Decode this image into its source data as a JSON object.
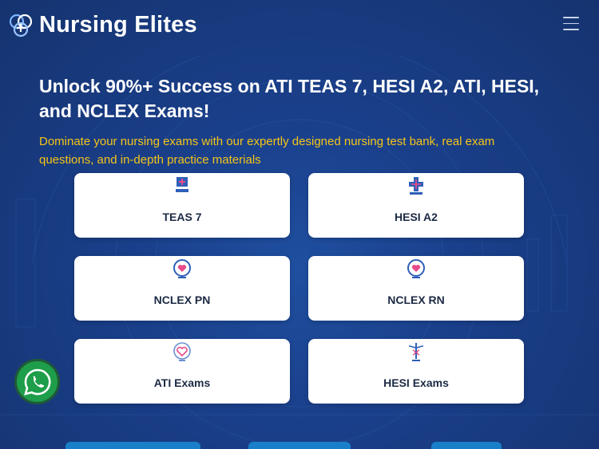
{
  "brand": {
    "name": "Nursing Elites",
    "accent_color": "#f5c518",
    "background_color": "#1a3f8a"
  },
  "header": {
    "logo_icon": "stethoscope-plus-icon",
    "menu_icon": "hamburger-menu-icon"
  },
  "hero": {
    "title": "Unlock 90%+ Success on ATI TEAS 7, HESI A2, ATI, HESI, and NCLEX Exams!",
    "subtitle": "Dominate your nursing exams with our expertly designed nursing test bank, real exam questions, and in-depth practice materials"
  },
  "exams": [
    {
      "label": "TEAS 7",
      "icon": "teas7-logo-icon"
    },
    {
      "label": "HESI A2",
      "icon": "hesi-a2-logo-icon"
    },
    {
      "label": "NCLEX PN",
      "icon": "nclex-heart-logo-icon"
    },
    {
      "label": "NCLEX RN",
      "icon": "nclex-heart-logo-icon"
    },
    {
      "label": "ATI Exams",
      "icon": "ati-heart-logo-icon"
    },
    {
      "label": "HESI Exams",
      "icon": "caduceus-logo-icon"
    }
  ],
  "floating": {
    "whatsapp_icon": "whatsapp-icon"
  }
}
